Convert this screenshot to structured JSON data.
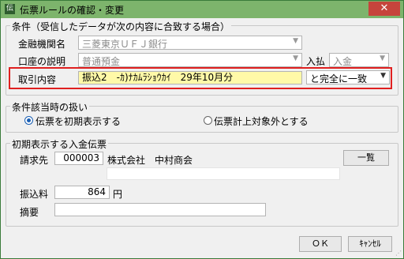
{
  "window": {
    "title": "伝票ルールの確認・変更",
    "icon_text": "伝",
    "close_glyph": "✕"
  },
  "conditions": {
    "title": "条件（受信したデータが次の内容に合致する場合）",
    "bank_label": "金融機関名",
    "bank_value": "三菱東京ＵＦＪ銀行",
    "account_label": "口座の説明",
    "account_value": "普通預金",
    "inout_label": "入払",
    "inout_value": "入金",
    "content_label": "取引内容",
    "content_value": "振込2　-ｶ)ﾅｶﾑﾗｼｮｳｶｲ　29年10月分",
    "match_value": "と完全に一致",
    "highlight_color": "#e02020",
    "input_highlight_color": "#fff9a8"
  },
  "handling": {
    "title": "条件該当時の扱い",
    "option1": "伝票を初期表示する",
    "option2": "伝票計上対象外とする",
    "selected": "option1"
  },
  "initial": {
    "title": "初期表示する入金伝票",
    "billing_label": "請求先",
    "billing_code": "000003",
    "billing_name": "株式会社　中村商会",
    "list_button": "一覧",
    "fee_label": "振込料",
    "fee_value": "864",
    "fee_unit": "円",
    "memo_label": "摘要",
    "memo_value": ""
  },
  "footer": {
    "ok": "ＯＫ",
    "cancel": "ｷｬﾝｾﾙ"
  },
  "icons": {
    "dropdown": "▼",
    "grip": "⋰"
  }
}
